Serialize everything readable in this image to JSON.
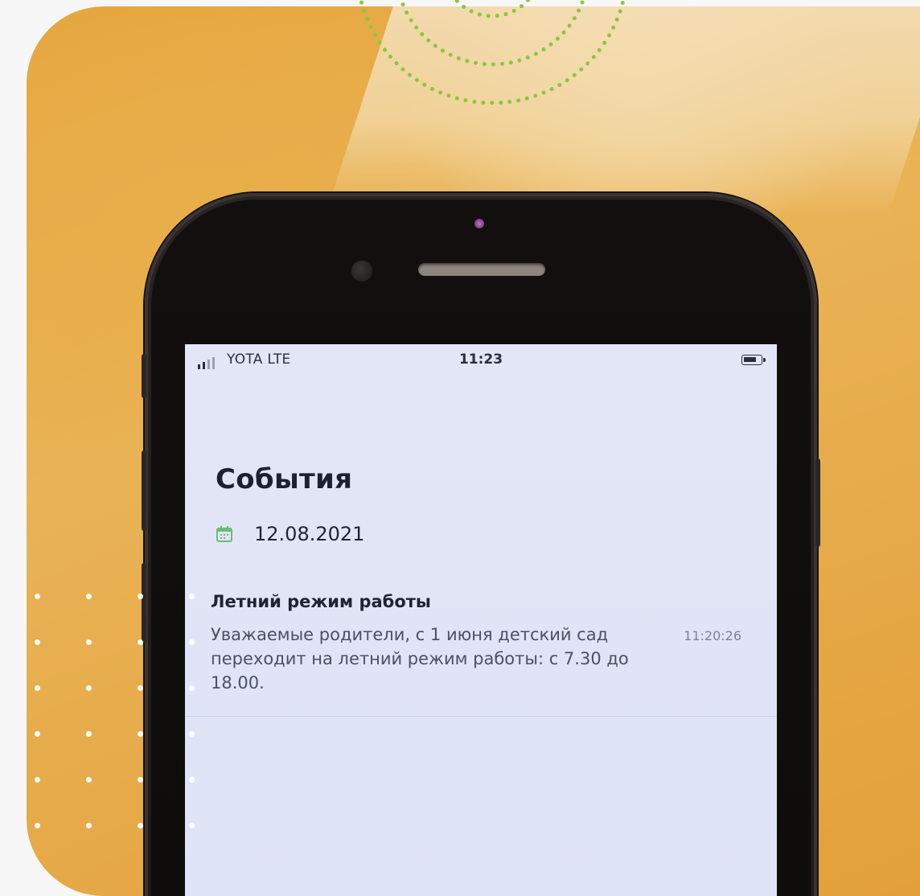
{
  "status_bar": {
    "carrier": "YOTA  LTE",
    "time": "11:23"
  },
  "screen": {
    "title": "События",
    "date": "12.08.2021",
    "event": {
      "title": "Летний режим работы",
      "body": "Уважаемые родители, с 1 июня детский сад переходит на летний режим работы: с 7.30 до 18.00.",
      "time": "11:20:26"
    }
  },
  "icons": {
    "calendar": "calendar-icon",
    "signal": "signal-icon",
    "battery": "battery-icon"
  },
  "colors": {
    "background_photo": "#e6a63f",
    "ring_dots": "#8cc63f",
    "calendar_icon": "#6dbb7a",
    "screen_bg": "#e1e4f6"
  }
}
